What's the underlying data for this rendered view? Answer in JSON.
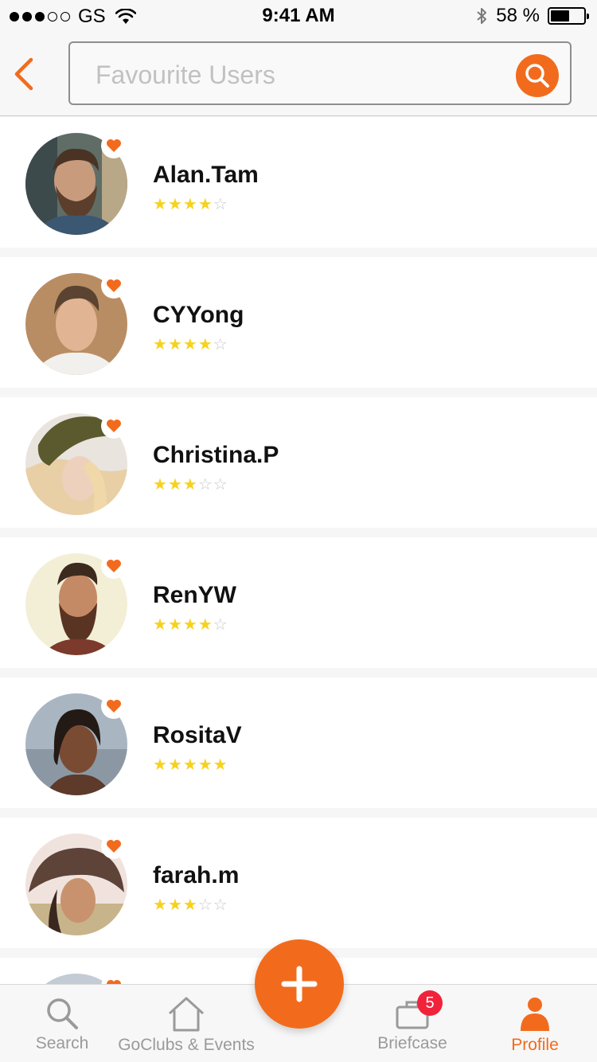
{
  "status_bar": {
    "carrier": "GS",
    "time": "9:41 AM",
    "battery": "58 %",
    "battery_level": 0.58,
    "signal_bars_filled": 3,
    "signal_bars_total": 5
  },
  "header": {
    "search_placeholder": "Favourite Users"
  },
  "users": [
    {
      "name": "Alan.Tam",
      "rating": 4,
      "max_rating": 5
    },
    {
      "name": "CYYong",
      "rating": 4,
      "max_rating": 5
    },
    {
      "name": "Christina.P",
      "rating": 3,
      "max_rating": 5
    },
    {
      "name": "RenYW",
      "rating": 4,
      "max_rating": 5
    },
    {
      "name": "RositaV",
      "rating": 5,
      "max_rating": 5
    },
    {
      "name": "farah.m",
      "rating": 3,
      "max_rating": 5
    }
  ],
  "tabbar": {
    "tabs": [
      {
        "label": "Search",
        "icon": "search-icon"
      },
      {
        "label": "GoClubs & Events",
        "icon": "home-icon"
      },
      {
        "label": "Briefcase",
        "icon": "briefcase-icon"
      },
      {
        "label": "Profile",
        "icon": "profile-icon"
      }
    ],
    "briefcase_badge": "5",
    "active_tab": "Profile"
  },
  "colors": {
    "accent": "#f26b1d",
    "star": "#f6d21f",
    "badge": "#f0233b"
  }
}
